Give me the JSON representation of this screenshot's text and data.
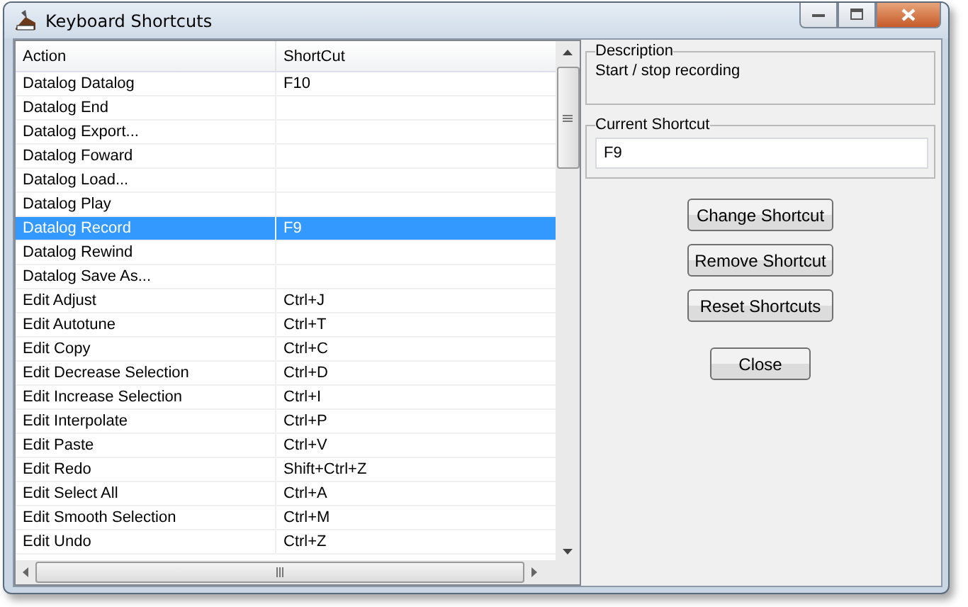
{
  "window": {
    "title": "Keyboard Shortcuts"
  },
  "table": {
    "columns": [
      "Action",
      "ShortCut"
    ],
    "rows": [
      {
        "action": "Datalog Datalog",
        "shortcut": "F10",
        "selected": false
      },
      {
        "action": "Datalog End",
        "shortcut": "",
        "selected": false
      },
      {
        "action": "Datalog Export...",
        "shortcut": "",
        "selected": false
      },
      {
        "action": "Datalog Foward",
        "shortcut": "",
        "selected": false
      },
      {
        "action": "Datalog Load...",
        "shortcut": "",
        "selected": false
      },
      {
        "action": "Datalog Play",
        "shortcut": "",
        "selected": false
      },
      {
        "action": "Datalog Record",
        "shortcut": "F9",
        "selected": true
      },
      {
        "action": "Datalog Rewind",
        "shortcut": "",
        "selected": false
      },
      {
        "action": "Datalog Save As...",
        "shortcut": "",
        "selected": false
      },
      {
        "action": "Edit Adjust",
        "shortcut": "Ctrl+J",
        "selected": false
      },
      {
        "action": "Edit Autotune",
        "shortcut": "Ctrl+T",
        "selected": false
      },
      {
        "action": "Edit Copy",
        "shortcut": "Ctrl+C",
        "selected": false
      },
      {
        "action": "Edit Decrease Selection",
        "shortcut": "Ctrl+D",
        "selected": false
      },
      {
        "action": "Edit Increase Selection",
        "shortcut": "Ctrl+I",
        "selected": false
      },
      {
        "action": "Edit Interpolate",
        "shortcut": "Ctrl+P",
        "selected": false
      },
      {
        "action": "Edit Paste",
        "shortcut": "Ctrl+V",
        "selected": false
      },
      {
        "action": "Edit Redo",
        "shortcut": "Shift+Ctrl+Z",
        "selected": false
      },
      {
        "action": "Edit Select All",
        "shortcut": "Ctrl+A",
        "selected": false
      },
      {
        "action": "Edit Smooth Selection",
        "shortcut": "Ctrl+M",
        "selected": false
      },
      {
        "action": "Edit Undo",
        "shortcut": "Ctrl+Z",
        "selected": false
      }
    ]
  },
  "description": {
    "label": "Description",
    "text": "Start / stop recording"
  },
  "current_shortcut": {
    "label": "Current Shortcut",
    "value": "F9"
  },
  "buttons": [
    "Change Shortcut",
    "Remove Shortcut",
    "Reset Shortcuts"
  ],
  "close_button": "Close"
}
